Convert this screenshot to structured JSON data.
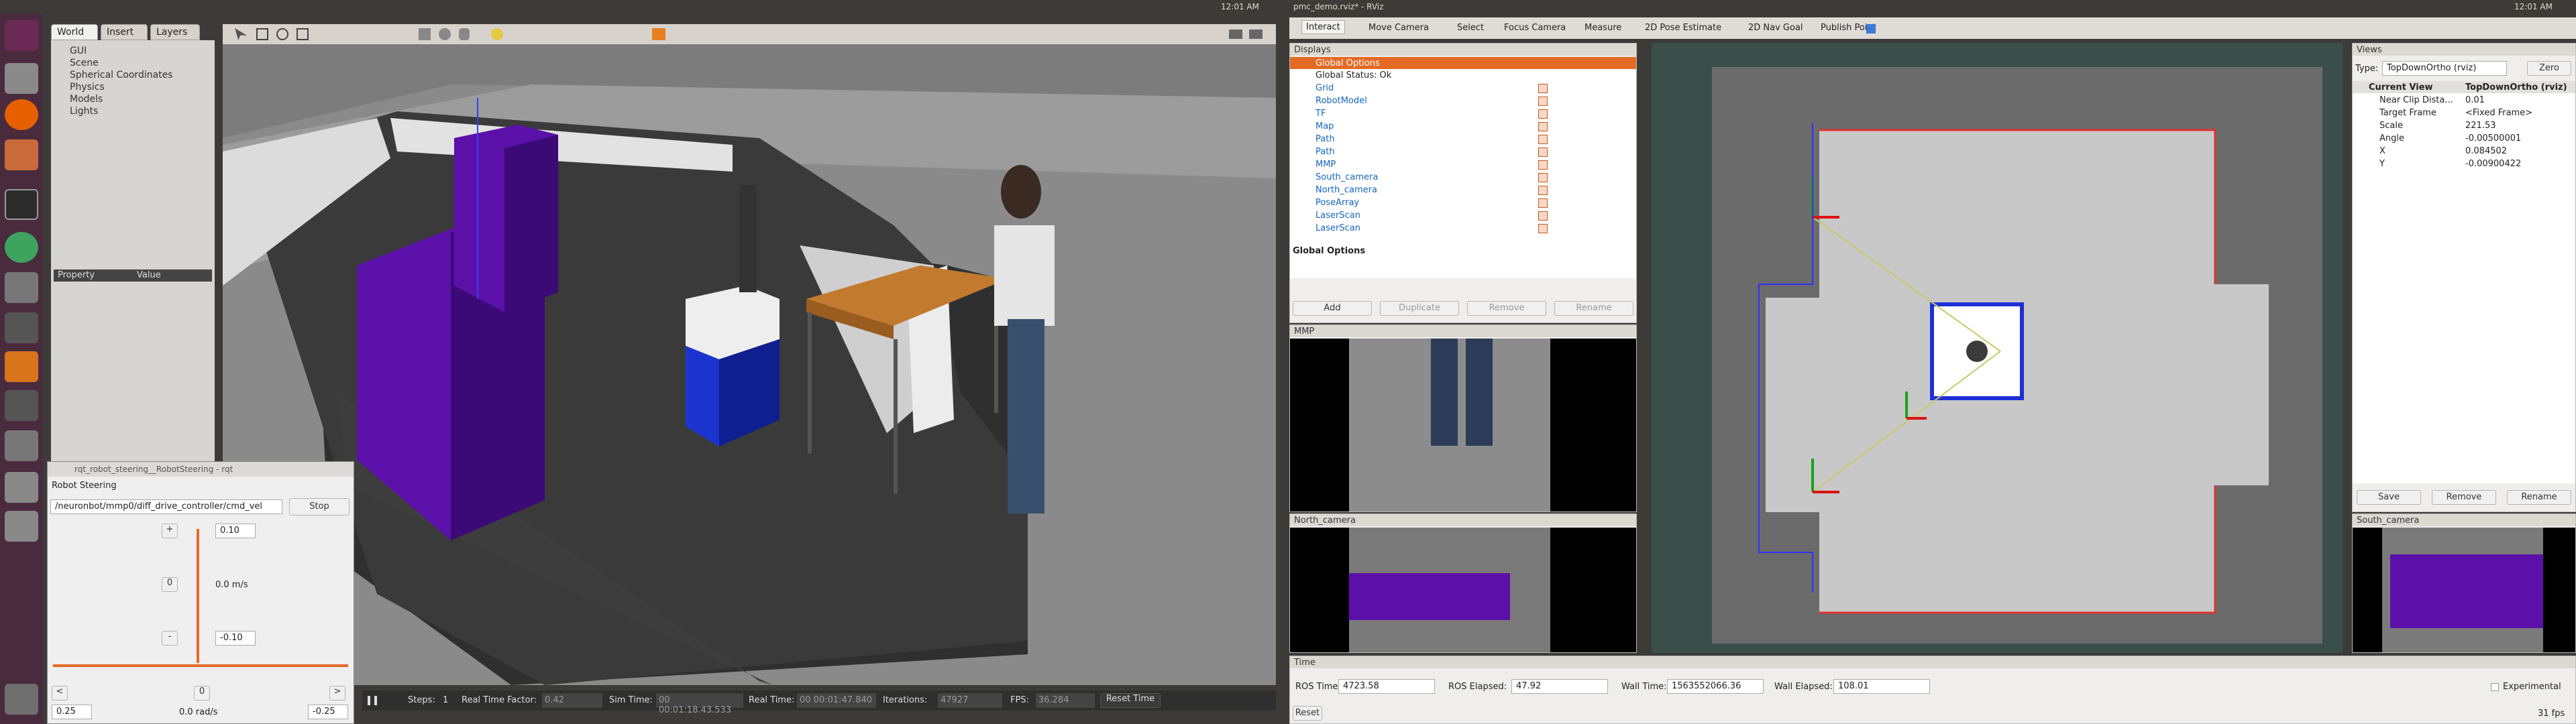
{
  "top_left": {
    "clock": "12:01 AM"
  },
  "top_right": {
    "title": "pmc_demo.rviz* - RViz",
    "clock": "12:01 AM"
  },
  "gazebo": {
    "tabs": [
      "World",
      "Insert",
      "Layers"
    ],
    "tree": [
      "GUI",
      "Scene",
      "Spherical Coordinates",
      "Physics",
      "Models",
      "Lights"
    ],
    "prop_headers": {
      "property": "Property",
      "value": "Value"
    },
    "simbar": {
      "steps_label": "Steps:",
      "steps": "1",
      "rtf_label": "Real Time Factor:",
      "rtf": "0.42",
      "simtime_label": "Sim Time:",
      "simtime": "00 00:01:18.43.533",
      "realtime_label": "Real Time:",
      "realtime": "00 00:01:47.840",
      "iter_label": "Iterations:",
      "iter": "47927",
      "fps_label": "FPS:",
      "fps": "36.284",
      "reset": "Reset Time"
    }
  },
  "rqt": {
    "window_title": "rqt_robot_steering__RobotSteering - rqt",
    "plugin": "Robot Steering",
    "topic": "/neuronbot/mmp0/diff_drive_controller/cmd_vel",
    "stop": "Stop",
    "plus": "+",
    "minus": "-",
    "lin_max": "0.10",
    "lin_min": "-0.10",
    "lin_zero": "0",
    "lin_val": "0.0 m/s",
    "ang_left": "<",
    "ang_right": ">",
    "ang_zero": "0",
    "ang_val": "0.0 rad/s",
    "ang_min": "0.25",
    "ang_max": "-0.25"
  },
  "rviz": {
    "tools": [
      "Interact",
      "Move Camera",
      "Select",
      "Focus Camera",
      "Measure",
      "2D Pose Estimate",
      "2D Nav Goal",
      "Publish Point"
    ],
    "displays_title": "Displays",
    "displays": [
      {
        "name": "Global Options",
        "sel": true
      },
      {
        "name": "Global Status: Ok",
        "sel": false,
        "plain": true
      },
      {
        "name": "Grid"
      },
      {
        "name": "RobotModel"
      },
      {
        "name": "TF"
      },
      {
        "name": "Map"
      },
      {
        "name": "Path"
      },
      {
        "name": "Path"
      },
      {
        "name": "MMP"
      },
      {
        "name": "South_camera"
      },
      {
        "name": "North_camera"
      },
      {
        "name": "PoseArray"
      },
      {
        "name": "LaserScan"
      },
      {
        "name": "LaserScan"
      }
    ],
    "desc_title": "Global Options",
    "disp_buttons": [
      "Add",
      "Duplicate",
      "Remove",
      "Rename"
    ],
    "mmp_title": "MMP",
    "north_title": "North_camera",
    "south_title": "South_camera",
    "views": {
      "title": "Views",
      "type_label": "Type:",
      "type": "TopDownOrtho (rviz)",
      "zero": "Zero",
      "rows": [
        [
          "Current View",
          "TopDownOrtho (rviz)"
        ],
        [
          "Near Clip Dista...",
          "0.01"
        ],
        [
          "Target Frame",
          "<Fixed Frame>"
        ],
        [
          "Scale",
          "221.53"
        ],
        [
          "Angle",
          "-0.00500001"
        ],
        [
          "X",
          "0.084502"
        ],
        [
          "Y",
          "-0.00900422"
        ]
      ],
      "buttons": [
        "Save",
        "Remove",
        "Rename"
      ]
    },
    "time": {
      "title": "Time",
      "ros_time_label": "ROS Time:",
      "ros_time": "4723.58",
      "ros_elapsed_label": "ROS Elapsed:",
      "ros_elapsed": "47.92",
      "wall_time_label": "Wall Time:",
      "wall_time": "1563552066.36",
      "wall_elapsed_label": "Wall Elapsed:",
      "wall_elapsed": "108.01",
      "experimental": "Experimental",
      "reset": "Reset",
      "fps": "31 fps"
    }
  },
  "colors": {
    "accent": "#e46a26",
    "robot_blue": "#1f2fd6",
    "purple": "#5a0fa8"
  }
}
